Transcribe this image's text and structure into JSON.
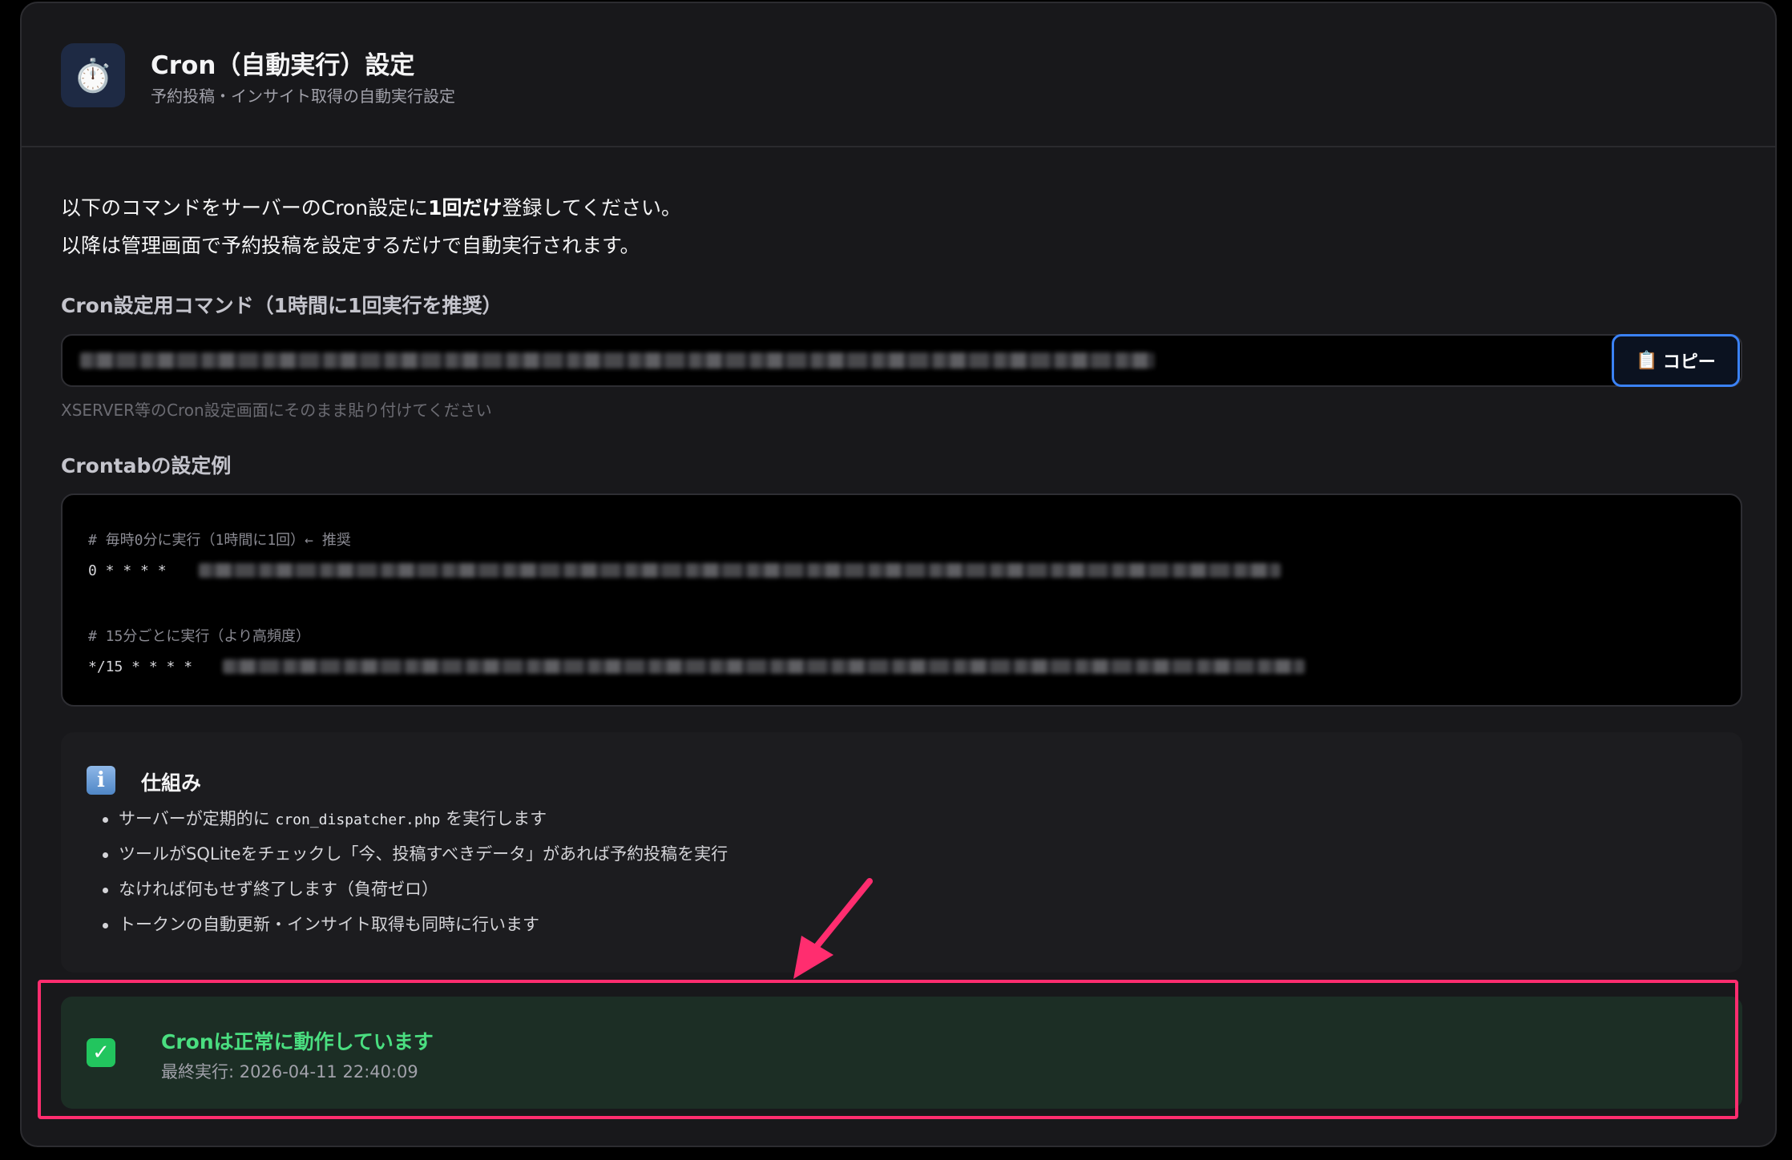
{
  "header": {
    "icon": "stopwatch-icon",
    "title": "Cron（自動実行）設定",
    "subtitle": "予約投稿・インサイト取得の自動実行設定"
  },
  "intro": {
    "line1_before": "以下のコマンドをサーバーのCron設定に",
    "line1_bold": "1回だけ",
    "line1_after": "登録してください。",
    "line2": "以降は管理画面で予約投稿を設定するだけで自動実行されます。"
  },
  "command": {
    "label": "Cron設定用コマンド（1時間に1回実行を推奨）",
    "copy_icon": "clipboard-icon",
    "copy_label": "コピー",
    "hint": "XSERVER等のCron設定画面にそのまま貼り付けてください"
  },
  "crontab": {
    "label": "Crontabの設定例",
    "comment1": "# 毎時0分に実行（1時間に1回）← 推奨",
    "prefix1": "0 * * * *",
    "comment2": "# 15分ごとに実行（より高頻度）",
    "prefix2": "*/15 * * * *"
  },
  "info": {
    "icon": "info-icon",
    "title": "仕組み",
    "item1_before": "サーバーが定期的に",
    "item1_code": "cron_dispatcher.php",
    "item1_after": "を実行します",
    "item2": "ツールがSQLiteをチェックし「今、投稿すべきデータ」があれば予約投稿を実行",
    "item3": "なければ何もせず終了します（負荷ゼロ）",
    "item4": "トークンの自動更新・インサイト取得も同時に行います"
  },
  "status": {
    "icon": "check-icon",
    "title": "Cronは正常に動作しています",
    "last_run": "最終実行: 2026-04-11 22:40:09"
  },
  "colors": {
    "accent_blue": "#3b82f6",
    "success_green": "#4ade80",
    "highlight_pink": "#ff2d6f"
  }
}
